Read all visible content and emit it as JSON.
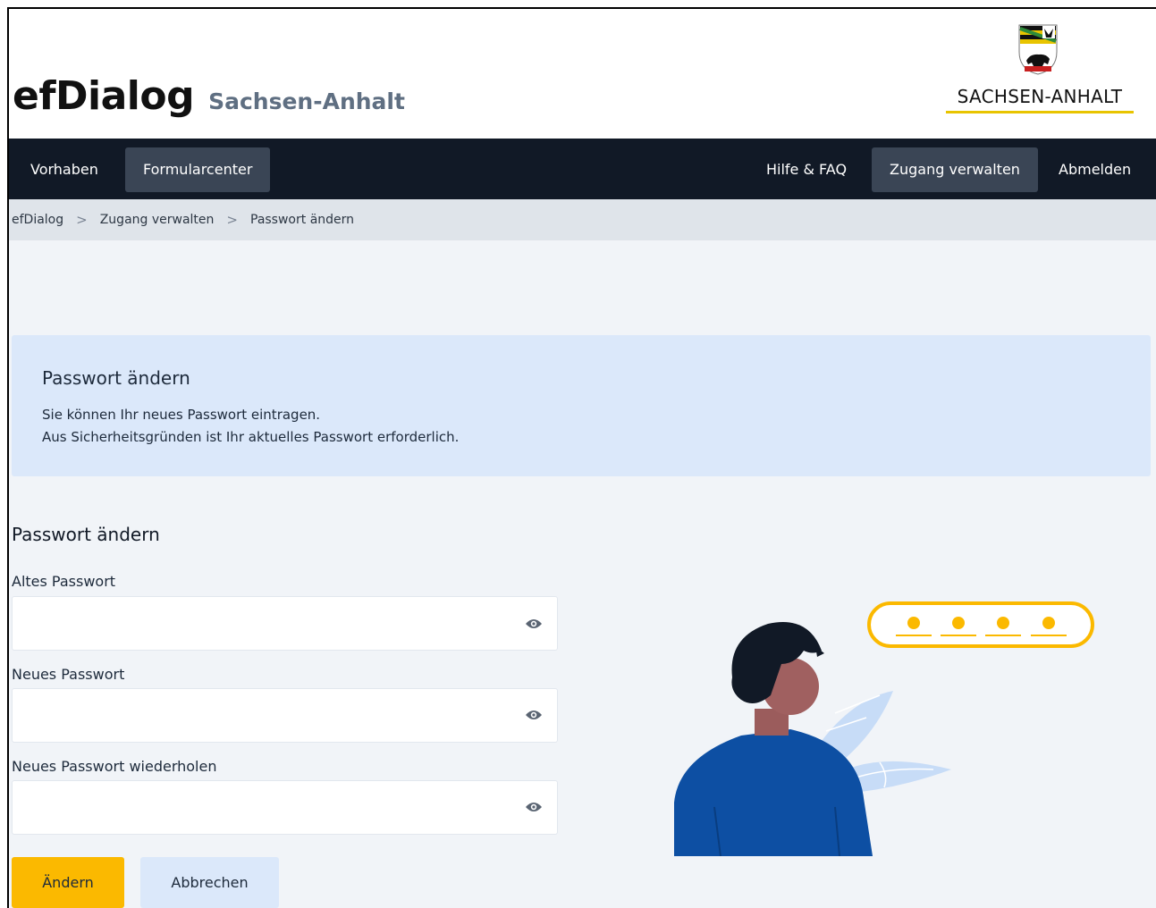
{
  "header": {
    "brand": "efDialog",
    "region": "Sachsen-Anhalt",
    "state_logo_text": "SACHSEN-ANHALT"
  },
  "nav": {
    "left": [
      {
        "label": "Vorhaben",
        "active": false
      },
      {
        "label": "Formularcenter",
        "active": true
      }
    ],
    "right": [
      {
        "label": "Hilfe & FAQ",
        "active": false
      },
      {
        "label": "Zugang verwalten",
        "active": true
      },
      {
        "label": "Abmelden",
        "active": false
      }
    ]
  },
  "breadcrumb": {
    "items": [
      "efDialog",
      "Zugang verwalten",
      "Passwort ändern"
    ],
    "separator": ">"
  },
  "info": {
    "title": "Passwort ändern",
    "line1": "Sie können Ihr neues Passwort eintragen.",
    "line2": "Aus Sicherheitsgründen ist Ihr aktuelles Passwort erforderlich."
  },
  "form": {
    "heading": "Passwort ändern",
    "fields": [
      {
        "label": "Altes Passwort",
        "value": ""
      },
      {
        "label": "Neues Passwort",
        "value": ""
      },
      {
        "label": "Neues Passwort wiederholen",
        "value": ""
      }
    ],
    "submit_label": "Ändern",
    "cancel_label": "Abbrechen"
  },
  "colors": {
    "nav_bg": "#111926",
    "nav_active": "#3a4555",
    "accent_yellow": "#fbb900",
    "info_bg": "#dbe8fa",
    "page_bg": "#f1f4f8",
    "person_jacket": "#0d4fa3"
  },
  "icons": {
    "field_toggle": "eye-icon",
    "state_logo": "coat-of-arms-icon"
  }
}
